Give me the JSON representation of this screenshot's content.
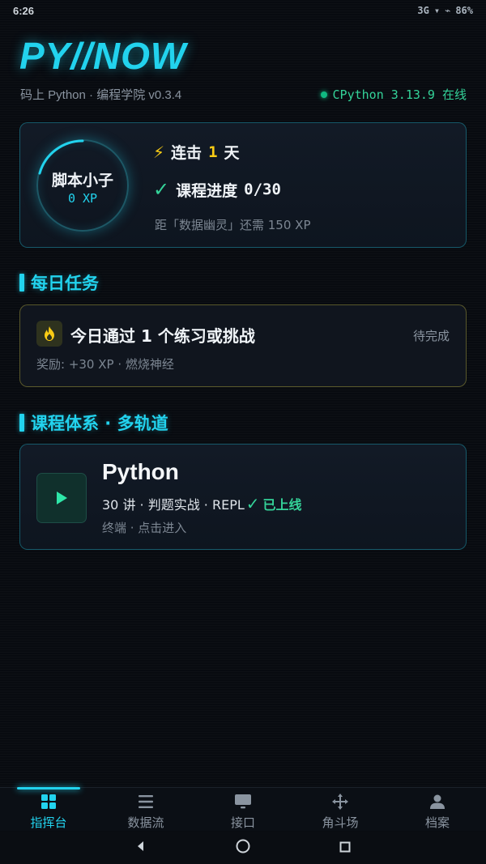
{
  "status_bar": {
    "time": "6:26",
    "network": "3G",
    "battery": "86%"
  },
  "app": {
    "logo": "PY//NOW",
    "subtitle": "码上 Python · 编程学院 v0.3.4",
    "runtime_status": "CPython 3.13.9 在线",
    "accent_color": "#22d3ee",
    "online_color": "#34d399"
  },
  "profile": {
    "rank": "脚本小子",
    "xp": "0 XP",
    "streak_prefix": "连击",
    "streak_days": "1",
    "streak_suffix": "天",
    "progress_label": "课程进度",
    "progress_value": "0/30",
    "next_rank_text": "距「数据幽灵」还需 150 XP"
  },
  "daily": {
    "section_title": "每日任务",
    "task_text": "今日通过 1 个练习或挑战",
    "task_status": "待完成",
    "reward_text": "奖励: +30 XP · 燃烧神经",
    "icon": "flame-icon"
  },
  "courses": {
    "section_title": "课程体系 · 多轨道",
    "items": [
      {
        "name": "Python",
        "meta": "30 讲 · 判题实战 · REPL",
        "status": "已上线",
        "hint": "终端 · 点击进入",
        "icon": "play-icon"
      }
    ]
  },
  "nav": {
    "items": [
      {
        "label": "指挥台",
        "icon": "dashboard-grid-icon",
        "active": true
      },
      {
        "label": "数据流",
        "icon": "list-icon",
        "active": false
      },
      {
        "label": "接口",
        "icon": "monitor-icon",
        "active": false
      },
      {
        "label": "角斗场",
        "icon": "move-arrows-icon",
        "active": false
      },
      {
        "label": "档案",
        "icon": "person-icon",
        "active": false
      }
    ]
  }
}
